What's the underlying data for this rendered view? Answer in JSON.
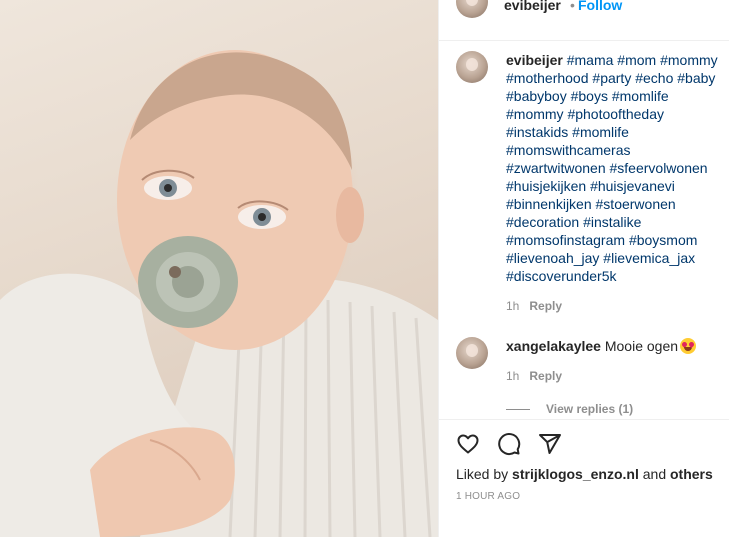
{
  "post": {
    "author": "evibeijer",
    "separator": "•",
    "follow_label": "Follow",
    "image_alt": "baby with pacifier"
  },
  "caption": {
    "username": "evibeijer",
    "hashtags": [
      "#mama",
      "#mom",
      "#mommy",
      "#motherhood",
      "#party",
      "#echo",
      "#baby",
      "#babyboy",
      "#boys",
      "#momlife",
      "#mommy",
      "#photooftheday",
      "#instakids",
      "#momlife",
      "#momswithcameras",
      "#zwartwitwonen",
      "#sfeervolwonen",
      "#huisjekijken",
      "#huisjevanevi",
      "#binnenkijken",
      "#stoerwonen",
      "#decoration",
      "#instalike",
      "#momsofinstagram",
      "#boysmom",
      "#lievenoah_jay",
      "#lievemica_jax",
      "#discoverunder5k"
    ],
    "time": "1h",
    "reply_label": "Reply"
  },
  "comment": {
    "username": "xangelakaylee",
    "text": "Mooie ogen",
    "time": "1h",
    "reply_label": "Reply",
    "view_replies": "View replies (1)"
  },
  "actions": {
    "icons": [
      "heart-icon",
      "comment-icon",
      "share-icon"
    ]
  },
  "likes": {
    "prefix": "Liked by",
    "user": "strijklogos_enzo.nl",
    "conjunction": "and",
    "others": "others"
  },
  "timestamp": "1 HOUR AGO",
  "colors": {
    "link": "#00376b",
    "follow": "#0095f6",
    "muted": "#8e8e8e",
    "text": "#262626"
  }
}
